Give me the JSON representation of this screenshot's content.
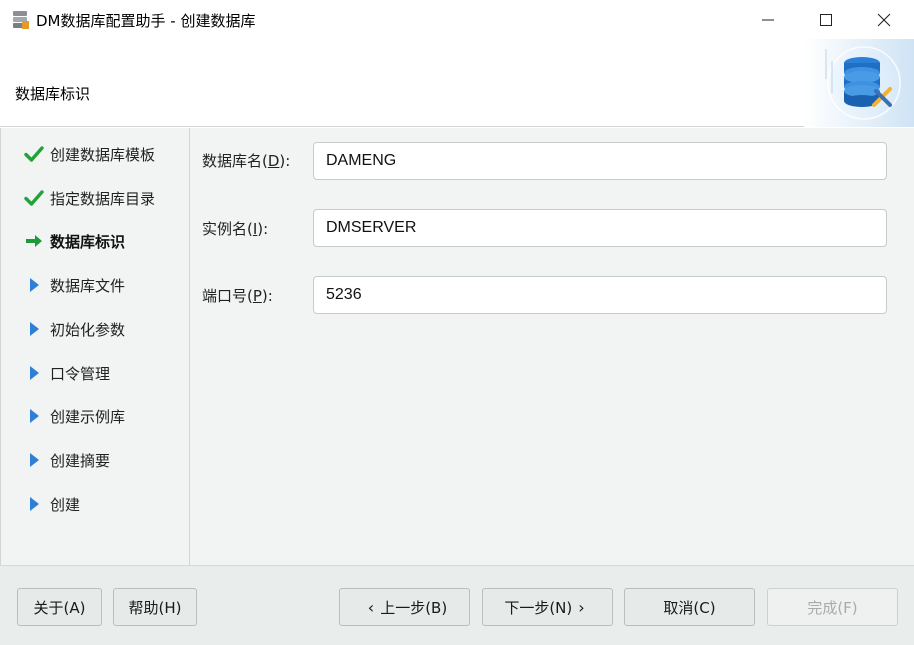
{
  "window": {
    "title": "DM数据库配置助手 - 创建数据库",
    "app_icon": "database-stack-icon",
    "controls": [
      "minimize-icon",
      "maximize-icon",
      "close-icon"
    ]
  },
  "header": {
    "title": "数据库标识",
    "graphic": "database-tools-icon"
  },
  "steps": [
    {
      "label": "创建数据库模板",
      "state": "done",
      "icon": "check-icon"
    },
    {
      "label": "指定数据库目录",
      "state": "done",
      "icon": "check-icon"
    },
    {
      "label": "数据库标识",
      "state": "current",
      "icon": "arrow-right-icon"
    },
    {
      "label": "数据库文件",
      "state": "pending",
      "icon": "triangle-right-icon"
    },
    {
      "label": "初始化参数",
      "state": "pending",
      "icon": "triangle-right-icon"
    },
    {
      "label": "口令管理",
      "state": "pending",
      "icon": "triangle-right-icon"
    },
    {
      "label": "创建示例库",
      "state": "pending",
      "icon": "triangle-right-icon"
    },
    {
      "label": "创建摘要",
      "state": "pending",
      "icon": "triangle-right-icon"
    },
    {
      "label": "创建",
      "state": "pending",
      "icon": "triangle-right-icon"
    }
  ],
  "form": {
    "db_name": {
      "label_pre": "数据库名(",
      "mnemonic": "D",
      "label_post": "):",
      "value": "DAMENG"
    },
    "instance_name": {
      "label_pre": "实例名(",
      "mnemonic": "I",
      "label_post": "):",
      "value": "DMSERVER"
    },
    "port": {
      "label_pre": "端口号(",
      "mnemonic": "P",
      "label_post": "):",
      "value": "5236"
    }
  },
  "footer": {
    "about": "关于(A)",
    "help": "帮助(H)",
    "prev": "上一步(B)",
    "next": "下一步(N)",
    "cancel": "取消(C)",
    "finish": "完成(F)"
  },
  "colors": {
    "check": "#22a33a",
    "arrow": "#1f9a3a",
    "triangle": "#2f7fd6",
    "panel_bg": "#f1f4f3"
  }
}
